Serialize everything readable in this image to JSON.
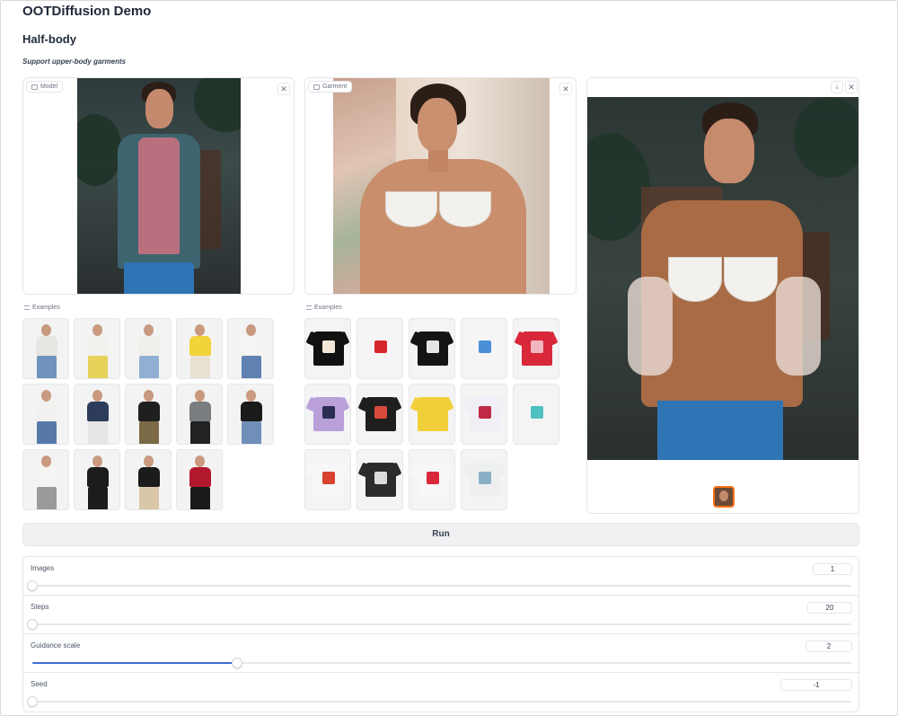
{
  "app": {
    "title": "OOTDiffusion Demo"
  },
  "section": {
    "title": "Half-body",
    "subtitle": "Support upper-body garments"
  },
  "model_panel": {
    "label": "Model",
    "close_icon": "close-icon"
  },
  "garment_panel": {
    "label": "Garment",
    "close_icon": "close-icon"
  },
  "result_panel": {
    "download_icon": "download-icon",
    "close_icon": "close-icon"
  },
  "model_examples": {
    "label": "Examples",
    "items": [
      {
        "top": "#e8e6e2",
        "bottom": "#6f93bd"
      },
      {
        "top": "#f3f1ee",
        "bottom": "#e7d35a"
      },
      {
        "top": "#f1efeb",
        "bottom": "#8fb0d3"
      },
      {
        "top": "#f2d33a",
        "bottom": "#e9e2d2"
      },
      {
        "top": "#f4f4f2",
        "bottom": "#5f82b2"
      },
      {
        "top": "#f1f1ef",
        "bottom": "#5679aa"
      },
      {
        "top": "#2d3c5a",
        "bottom": "#e6e6e6"
      },
      {
        "top": "#1f1f1f",
        "bottom": "#7b6a45"
      },
      {
        "top": "#7a7d80",
        "bottom": "#222222"
      },
      {
        "top": "#1a1a1a",
        "bottom": "#6f8fb8"
      },
      {
        "top": "#f4f4f2",
        "bottom": "#9a9a9a"
      },
      {
        "top": "#1c1c1c",
        "bottom": "#1c1c1c"
      },
      {
        "top": "#1b1b1b",
        "bottom": "#d9c7a8"
      },
      {
        "top": "#b3192e",
        "bottom": "#1b1b1b"
      }
    ]
  },
  "garment_examples": {
    "label": "Examples",
    "items": [
      {
        "shirt": "#111111",
        "print": "#f2e6d8"
      },
      {
        "shirt": "#f5f5f5",
        "print": "#d6262e"
      },
      {
        "shirt": "#141414",
        "print": "#e5e5e5"
      },
      {
        "shirt": "#f5f5f5",
        "print": "#4a90d9"
      },
      {
        "shirt": "#d8283a",
        "print": "#f2b6c0"
      },
      {
        "shirt": "#b9a0d9",
        "print": "#2c2c54"
      },
      {
        "shirt": "#1e1e1e",
        "print": "#d74a3c"
      },
      {
        "shirt": "#f1cf3a",
        "print": "#f1cf3a"
      },
      {
        "shirt": "#f2eef5",
        "print": "#c02a44"
      },
      {
        "shirt": "#f4f4f4",
        "print": "#4fc0c0"
      },
      {
        "shirt": "#f7f7f7",
        "print": "#d8412f"
      },
      {
        "shirt": "#2b2b2b",
        "print": "#dcdcdc"
      },
      {
        "shirt": "#f7f7f7",
        "print": "#d8283a"
      },
      {
        "shirt": "#eef0f0",
        "print": "#8ab0c8"
      }
    ]
  },
  "run": {
    "label": "Run"
  },
  "controls": [
    {
      "label": "Images",
      "value": "1",
      "fraction": 0.0
    },
    {
      "label": "Steps",
      "value": "20",
      "fraction": 0.0
    },
    {
      "label": "Guidance scale",
      "value": "2",
      "fraction": 0.25
    },
    {
      "label": "Seed",
      "value": "-1",
      "fraction": 0.0
    }
  ],
  "colors": {
    "accent": "#3b6fd0",
    "thumb_selected": "#f97316"
  }
}
